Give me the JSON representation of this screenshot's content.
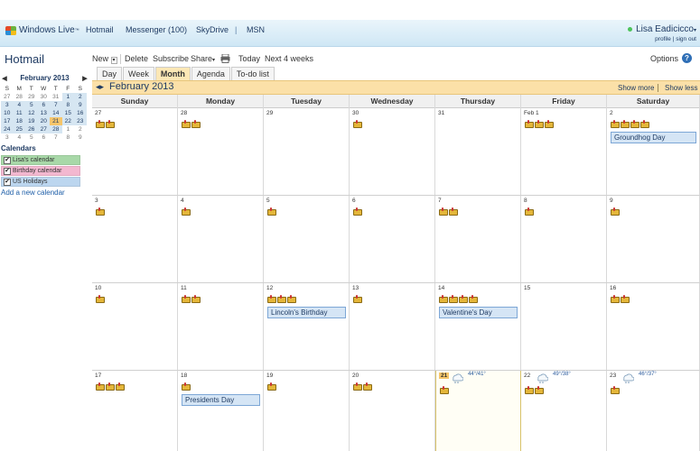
{
  "topbar": {
    "brand": "Windows Live",
    "brand_tm": "™",
    "nav": [
      "Hotmail",
      "Messenger (100)",
      "SkyDrive",
      "MSN"
    ],
    "user_name": "Lisa Eadicicco",
    "profile": "profile",
    "sep": "|",
    "signout": "sign out"
  },
  "sidebar": {
    "app_title": "Hotmail",
    "mini_month": "February 2013",
    "weekdays": [
      "S",
      "M",
      "T",
      "W",
      "T",
      "F",
      "S"
    ],
    "days": [
      [
        "27",
        "28",
        "29",
        "30",
        "31",
        "1",
        "2"
      ],
      [
        "3",
        "4",
        "5",
        "6",
        "7",
        "8",
        "9"
      ],
      [
        "10",
        "11",
        "12",
        "13",
        "14",
        "15",
        "16"
      ],
      [
        "17",
        "18",
        "19",
        "20",
        "21",
        "22",
        "23"
      ],
      [
        "24",
        "25",
        "26",
        "27",
        "28",
        "1",
        "2"
      ],
      [
        "3",
        "4",
        "5",
        "6",
        "7",
        "8",
        "9"
      ]
    ],
    "calendars_label": "Calendars",
    "calendars": [
      {
        "name": "Lisa's calendar",
        "color": "#a8d8a8"
      },
      {
        "name": "Birthday calendar",
        "color": "#f3b8d0"
      },
      {
        "name": "US Holidays",
        "color": "#bcd6ef"
      }
    ],
    "add_calendar": "Add a new calendar"
  },
  "toolbar": {
    "new": "New",
    "delete": "Delete",
    "subscribe": "Subscribe",
    "share": "Share",
    "today": "Today",
    "next4": "Next 4 weeks",
    "options": "Options",
    "help": "?"
  },
  "tabs": [
    "Day",
    "Week",
    "Month",
    "Agenda",
    "To-do list"
  ],
  "active_tab": "Month",
  "month": {
    "title": "February 2013",
    "show_more": "Show more",
    "show_less": "Show less"
  },
  "dow": [
    "Sunday",
    "Monday",
    "Tuesday",
    "Wednesday",
    "Thursday",
    "Friday",
    "Saturday"
  ],
  "weeks": [
    [
      {
        "d": "27",
        "cakes": 2
      },
      {
        "d": "28",
        "cakes": 2
      },
      {
        "d": "29",
        "cakes": 0
      },
      {
        "d": "30",
        "cakes": 1
      },
      {
        "d": "31",
        "cakes": 0
      },
      {
        "d": "Feb 1",
        "cakes": 3
      },
      {
        "d": "2",
        "cakes": 4,
        "event": "Groundhog Day"
      }
    ],
    [
      {
        "d": "3",
        "cakes": 1
      },
      {
        "d": "4",
        "cakes": 1
      },
      {
        "d": "5",
        "cakes": 1
      },
      {
        "d": "6",
        "cakes": 1
      },
      {
        "d": "7",
        "cakes": 2
      },
      {
        "d": "8",
        "cakes": 1
      },
      {
        "d": "9",
        "cakes": 1
      }
    ],
    [
      {
        "d": "10",
        "cakes": 1
      },
      {
        "d": "11",
        "cakes": 2
      },
      {
        "d": "12",
        "cakes": 3,
        "event": "Lincoln's Birthday"
      },
      {
        "d": "13",
        "cakes": 1
      },
      {
        "d": "14",
        "cakes": 4,
        "event": "Valentine's Day"
      },
      {
        "d": "15",
        "cakes": 0
      },
      {
        "d": "16",
        "cakes": 2
      }
    ],
    [
      {
        "d": "17",
        "cakes": 3
      },
      {
        "d": "18",
        "cakes": 1,
        "event": "Presidents Day"
      },
      {
        "d": "19",
        "cakes": 1
      },
      {
        "d": "20",
        "cakes": 2
      },
      {
        "d": "21",
        "cakes": 1,
        "today": true,
        "weather": "44°/41°"
      },
      {
        "d": "22",
        "cakes": 2,
        "weather": "49°/38°"
      },
      {
        "d": "23",
        "cakes": 1,
        "weather": "46°/37°"
      }
    ]
  ],
  "colors": {
    "accent": "#1f3b63",
    "today": "#f6c56a",
    "month_bar": "#fbe0a8",
    "event_bg": "#d5e5f5"
  }
}
